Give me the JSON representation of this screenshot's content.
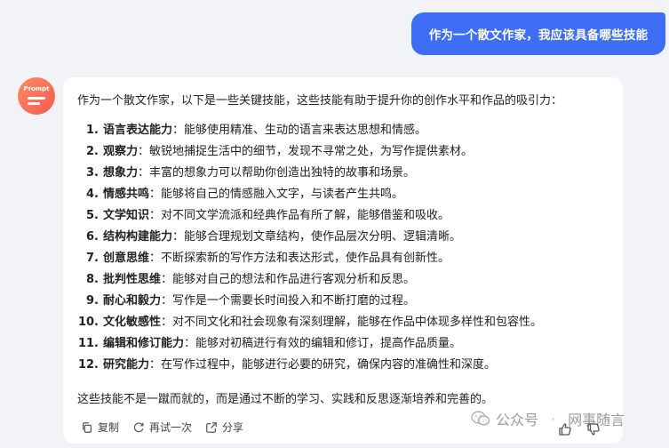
{
  "user_message": "作为一个散文作家，我应该具备哪些技能",
  "assistant": {
    "avatar_label": "Prompt",
    "intro": "作为一个散文作家，以下是一些关键技能，这些技能有助于提升你的创作水平和作品的吸引力：",
    "items": [
      {
        "num": "1.",
        "term": "语言表达能力",
        "desc": "：能够使用精准、生动的语言来表达思想和情感。"
      },
      {
        "num": "2.",
        "term": "观察力",
        "desc": "：敏锐地捕捉生活中的细节，发现不寻常之处，为写作提供素材。"
      },
      {
        "num": "3.",
        "term": "想象力",
        "desc": "：丰富的想象力可以帮助你创造出独特的故事和场景。"
      },
      {
        "num": "4.",
        "term": "情感共鸣",
        "desc": "：能够将自己的情感融入文字，与读者产生共鸣。"
      },
      {
        "num": "5.",
        "term": "文学知识",
        "desc": "：对不同文学流派和经典作品有所了解，能够借鉴和吸收。"
      },
      {
        "num": "6.",
        "term": "结构构建能力",
        "desc": "：能够合理规划文章结构，使作品层次分明、逻辑清晰。"
      },
      {
        "num": "7.",
        "term": "创意思维",
        "desc": "：不断探索新的写作方法和表达形式，使作品具有创新性。"
      },
      {
        "num": "8.",
        "term": "批判性思维",
        "desc": "：能够对自己的想法和作品进行客观分析和反思。"
      },
      {
        "num": "9.",
        "term": "耐心和毅力",
        "desc": "：写作是一个需要长时间投入和不断打磨的过程。"
      },
      {
        "num": "10.",
        "term": "文化敏感性",
        "desc": "：对不同文化和社会现象有深刻理解，能够在作品中体现多样性和包容性。"
      },
      {
        "num": "11.",
        "term": "编辑和修订能力",
        "desc": "：能够对初稿进行有效的编辑和修订，提高作品质量。"
      },
      {
        "num": "12.",
        "term": "研究能力",
        "desc": "：在写作过程中，能够进行必要的研究，确保内容的准确性和深度。"
      }
    ],
    "outro": "这些技能不是一蹴而就的，而是通过不断的学习、实践和反思逐渐培养和完善的。"
  },
  "actions": {
    "copy": "复制",
    "retry": "再试一次",
    "share": "分享"
  },
  "watermark": {
    "left": "公众号",
    "right": "网事随言"
  }
}
